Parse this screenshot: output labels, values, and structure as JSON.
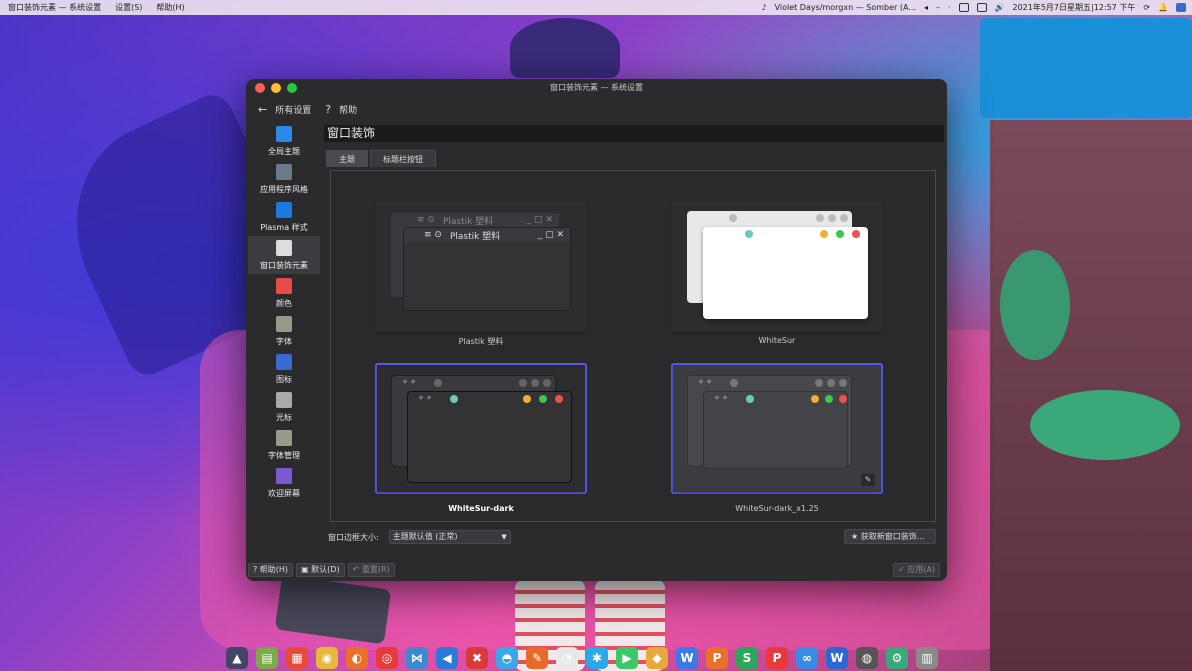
{
  "top_panel": {
    "app_title": "窗口装饰元素 — 系统设置",
    "menu_settings": "设置(S)",
    "menu_help": "帮助(H)",
    "music": "Violet Days/morgxn — Somber (A...",
    "datetime": "2021年5月7日星期五|12:57 下午"
  },
  "window": {
    "title": "窗口装饰元素 — 系统设置",
    "toolbar": {
      "back_glyph": "←",
      "all_settings": "所有设置",
      "help_glyph": "?",
      "help": "帮助"
    },
    "sidebar": [
      {
        "label": "全局主题",
        "icon": "global-theme-icon",
        "color": "#2a8ae8"
      },
      {
        "label": "应用程序风格",
        "icon": "app-style-icon",
        "color": "#6a7a8a"
      },
      {
        "label": "Plasma 样式",
        "icon": "plasma-style-icon",
        "color": "#1a7ae0"
      },
      {
        "label": "窗口装饰元素",
        "icon": "window-decoration-icon",
        "color": "#dddddd",
        "active": true
      },
      {
        "label": "颜色",
        "icon": "colors-icon",
        "color": "#e84a4a"
      },
      {
        "label": "字体",
        "icon": "font-icon",
        "color": "#9a9a8a"
      },
      {
        "label": "图标",
        "icon": "icons-icon",
        "color": "#3a6ad0"
      },
      {
        "label": "光标",
        "icon": "cursor-icon",
        "color": "#aaaaaa"
      },
      {
        "label": "字体管理",
        "icon": "font-manager-icon",
        "color": "#9a9a8a"
      },
      {
        "label": "欢迎屏幕",
        "icon": "splash-screen-icon",
        "color": "#7a5ad0"
      }
    ],
    "page_title": "窗口装饰",
    "tabs": [
      "主题",
      "标题栏按钮"
    ],
    "themes": [
      {
        "name": "Plastik 塑料",
        "preview_title": "Plastik 塑料"
      },
      {
        "name": "WhiteSur"
      },
      {
        "name": "WhiteSur-dark",
        "selected": true
      },
      {
        "name": "WhiteSur-dark_x1.25",
        "hover": true
      }
    ],
    "border_size_label": "窗口边框大小:",
    "border_size_value": "主题默认值 (正常)",
    "get_new": "获取新窗口装饰...",
    "footer": {
      "help": "帮助(H)",
      "defaults": "默认(D)",
      "reset": "重置(R)",
      "apply": "应用(A)"
    }
  },
  "dock": [
    {
      "icon": "launcher-icon",
      "color": "#444466",
      "glyph": "▲"
    },
    {
      "icon": "files-icon",
      "color": "#7aaa4a",
      "glyph": "▤"
    },
    {
      "icon": "app-store-icon",
      "color": "#e84a3a",
      "glyph": "▦"
    },
    {
      "icon": "chrome-icon",
      "color": "#e8b83a",
      "glyph": "◉"
    },
    {
      "icon": "firefox-icon",
      "color": "#e8702a",
      "glyph": "◐"
    },
    {
      "icon": "weibo-icon",
      "color": "#e83a3a",
      "glyph": "◎"
    },
    {
      "icon": "network-icon",
      "color": "#3a8ad0",
      "glyph": "⋈"
    },
    {
      "icon": "vscode-icon",
      "color": "#2a7ad8",
      "glyph": "◀"
    },
    {
      "icon": "xmind-icon",
      "color": "#d83a3a",
      "glyph": "✖"
    },
    {
      "icon": "chat-icon",
      "color": "#3aa8e8",
      "glyph": "◓"
    },
    {
      "icon": "pen-icon",
      "color": "#e86a2a",
      "glyph": "✎"
    },
    {
      "icon": "qq-icon",
      "color": "#e8e8e8",
      "glyph": "◔"
    },
    {
      "icon": "star-app-icon",
      "color": "#2aa8e8",
      "glyph": "✱"
    },
    {
      "icon": "play-icon",
      "color": "#3ac868",
      "glyph": "▶"
    },
    {
      "icon": "tool-icon",
      "color": "#e8a83a",
      "glyph": "◆"
    },
    {
      "icon": "wps-writer-icon",
      "color": "#3a7ae8",
      "glyph": "W"
    },
    {
      "icon": "wps-presentation-icon",
      "color": "#e8702a",
      "glyph": "P"
    },
    {
      "icon": "wps-spreadsheet-icon",
      "color": "#2aa85a",
      "glyph": "S"
    },
    {
      "icon": "wps-pdf-icon",
      "color": "#e83a3a",
      "glyph": "P"
    },
    {
      "icon": "baidu-netdisk-icon",
      "color": "#3a8ae8",
      "glyph": "∞"
    },
    {
      "icon": "docs-icon",
      "color": "#2a6ad0",
      "glyph": "W"
    },
    {
      "icon": "system-icon",
      "color": "#555555",
      "glyph": "◍"
    },
    {
      "icon": "settings-icon",
      "color": "#3aa878",
      "glyph": "⚙"
    },
    {
      "icon": "trash-icon",
      "color": "#8a8a8a",
      "glyph": "▥"
    }
  ]
}
